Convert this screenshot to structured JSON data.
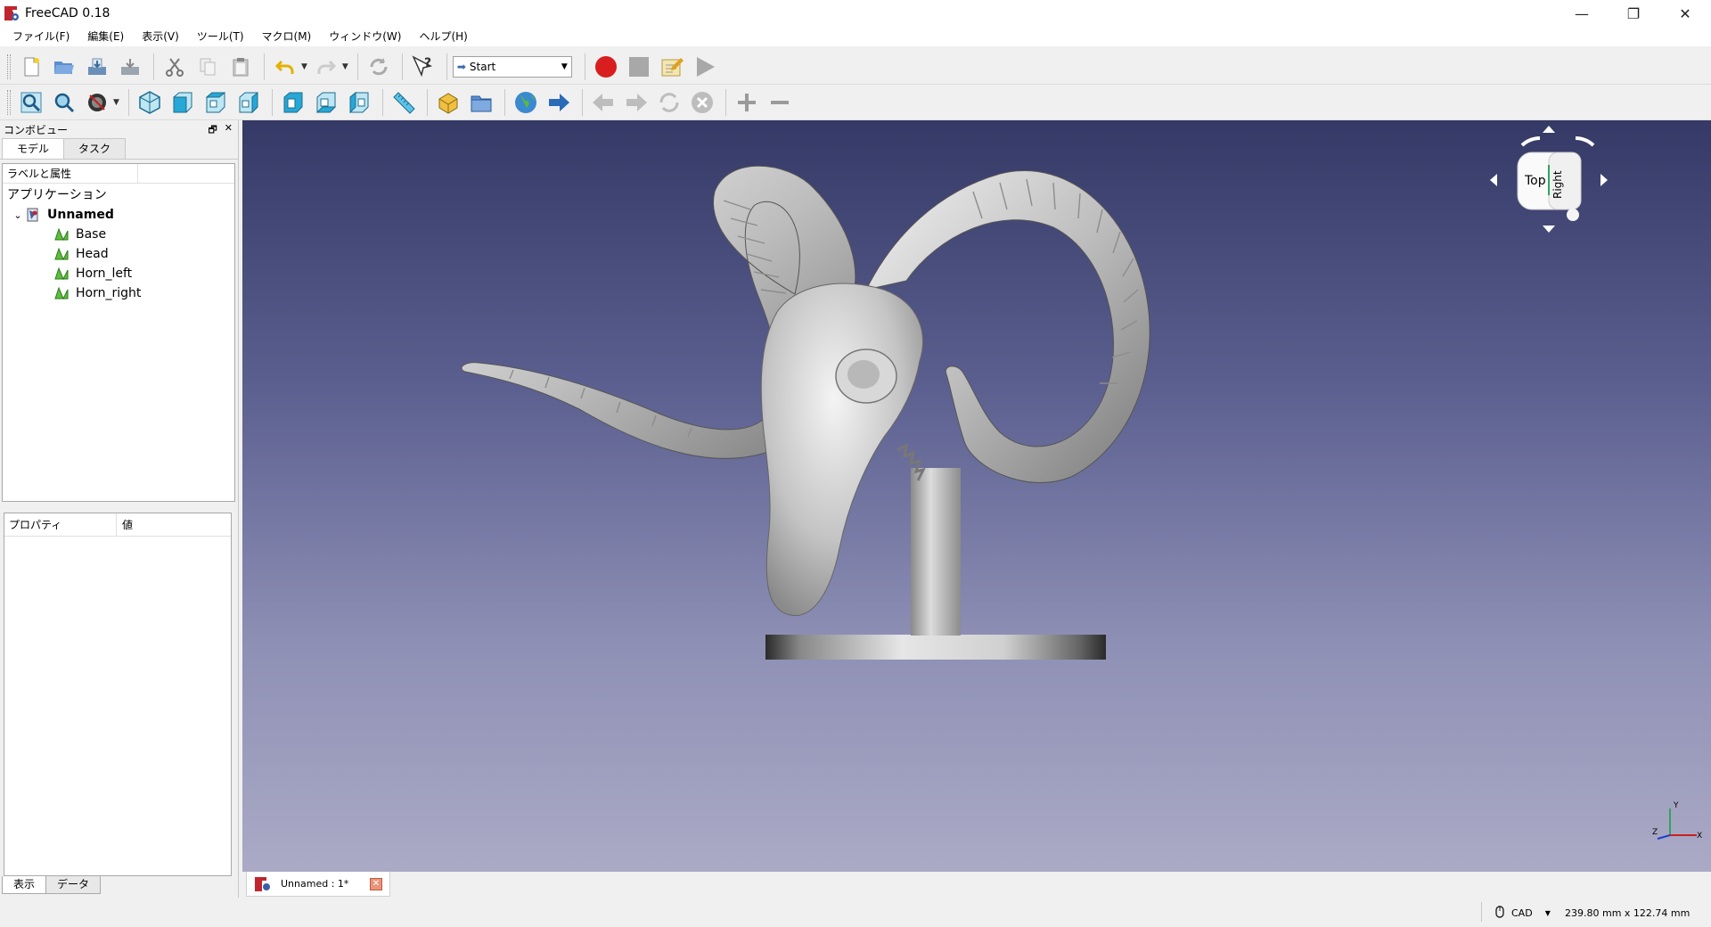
{
  "window": {
    "title": "FreeCAD 0.18",
    "minimize": "—",
    "maximize": "❐",
    "close": "✕"
  },
  "menu": [
    "ファイル(F)",
    "編集(E)",
    "表示(V)",
    "ツール(T)",
    "マクロ(M)",
    "ウィンドウ(W)",
    "ヘルプ(H)"
  ],
  "toolbar": {
    "workbench": "Start"
  },
  "combo": {
    "title": "コンボビュー",
    "tabs": [
      "モデル",
      "タスク"
    ],
    "tree_header": "ラベルと属性",
    "application_label": "アプリケーション",
    "document": "Unnamed",
    "objects": [
      "Base",
      "Head",
      "Horn_left",
      "Horn_right"
    ],
    "property_header": "プロパティ",
    "value_header": "値",
    "bottom_tabs": [
      "表示",
      "データ"
    ]
  },
  "navcube": {
    "top": "Top",
    "right": "Right"
  },
  "axis": {
    "y": "Y",
    "x": "X",
    "z": "Z"
  },
  "doc_tab": {
    "label": "Unnamed : 1*",
    "close": "✕"
  },
  "status": {
    "nav_style": "CAD",
    "dimensions": "239.80 mm x 122.74 mm"
  },
  "colors": {
    "viewport_top": "#353966",
    "viewport_bottom": "#abaac6",
    "record": "#d81e1e"
  }
}
